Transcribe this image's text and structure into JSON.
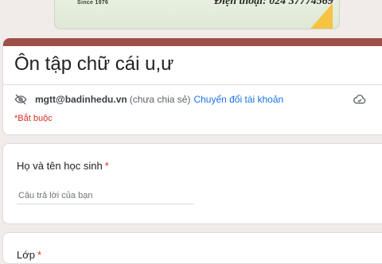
{
  "banner": {
    "since": "Since 1976",
    "phone": "Điện thoại: 024 37774569"
  },
  "form": {
    "title": "Ôn tập chữ cái u,ư",
    "account_email": "mgtt@badinhedu.vn",
    "account_note": "(chưa chia sẻ)",
    "switch_account": "Chuyển đổi tài khoản",
    "required_note": "*Bắt buộc"
  },
  "questions": [
    {
      "label": "Họ và tên học sinh",
      "required_mark": "*",
      "placeholder": "Câu trả lời của bạn"
    },
    {
      "label": "Lớp",
      "required_mark": "*"
    }
  ],
  "icons": {
    "privacy": "eye-off-icon",
    "cloud": "cloud-saved-icon"
  },
  "colors": {
    "theme": "#9f4f4a",
    "link": "#1a73e8",
    "required": "#d93025",
    "background": "#f1ebe9"
  }
}
